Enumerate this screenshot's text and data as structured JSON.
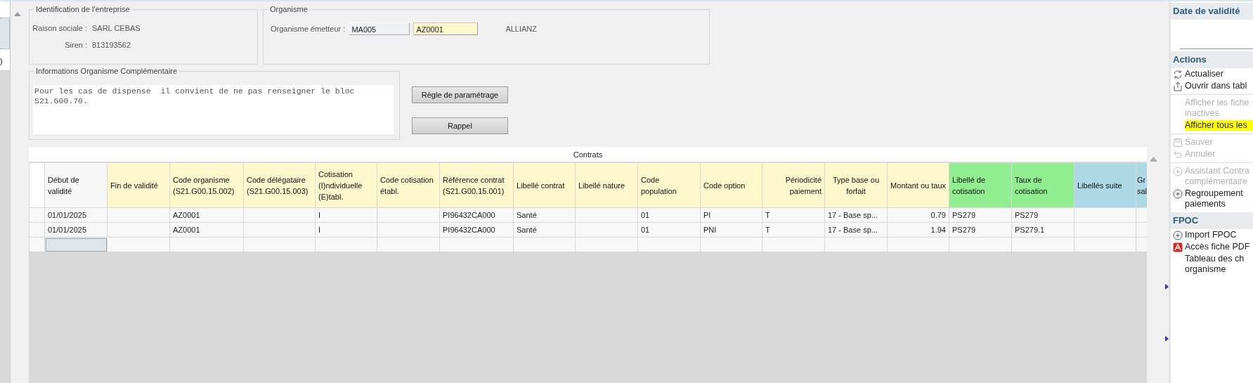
{
  "left_strip": {
    "text": ")"
  },
  "identification": {
    "title": "Identification de l'entreprise",
    "fields": [
      {
        "label": "Raison sociale :",
        "value": "SARL CEBAS"
      },
      {
        "label": "Siren :",
        "value": "813193562"
      }
    ]
  },
  "organisme": {
    "title": "Organisme",
    "label": "Organisme émetteur :",
    "code": "MA005",
    "value": "AZ0001",
    "name": "ALLIANZ"
  },
  "informations": {
    "title": "Informations Organisme Complémentaire",
    "text": "Pour les cas de dispense  il convient de ne pas renseigner le bloc S21.G00.70."
  },
  "buttons": [
    "Règle de paramétrage",
    "Rappel"
  ],
  "table": {
    "title": "Contrats",
    "columns": [
      {
        "label": "Début de validité",
        "color": "#f7f7f7"
      },
      {
        "label": "Fin de validité",
        "color": "#fff8cc"
      },
      {
        "label": "Code organisme (S21.G00.15.002)",
        "color": "#fff8cc"
      },
      {
        "label": "Code délégataire (S21.G00.15.003)",
        "color": "#fff8cc"
      },
      {
        "label": "Cotisation (I)ndividuelle (E)tabl.",
        "color": "#fff8cc"
      },
      {
        "label": "Code cotisation établ.",
        "color": "#fff8cc"
      },
      {
        "label": "Référence contrat (S21.G00.15.001)",
        "color": "#fff8cc"
      },
      {
        "label": "Libellé contrat",
        "color": "#fff8cc"
      },
      {
        "label": "Libellé nature",
        "color": "#fff8cc"
      },
      {
        "label": "Code population",
        "color": "#fff8cc"
      },
      {
        "label": "Code option",
        "color": "#fff8cc"
      },
      {
        "label": "Périodicité paiement",
        "color": "#fff8cc"
      },
      {
        "label": "Type base ou forfait",
        "color": "#fff8cc"
      },
      {
        "label": "Montant ou taux",
        "color": "#fff8cc"
      },
      {
        "label": "Libellé de cotisation",
        "color": "#90ee90"
      },
      {
        "label": "Taux de cotisation",
        "color": "#90ee90"
      },
      {
        "label": "Libellés suite",
        "color": "#add8e6"
      },
      {
        "label": "Gr sal",
        "color": "#add8e6"
      }
    ],
    "rows": [
      {
        "cells": [
          "01/01/2025",
          null,
          "AZ0001",
          null,
          "I",
          null,
          "PI96432CA000",
          "Santé",
          null,
          "01",
          "PI",
          "T",
          "17 - Base sp...",
          "0.79",
          "PS279",
          "PS279",
          null,
          null
        ]
      },
      {
        "cells": [
          "01/01/2025",
          null,
          "AZ0001",
          null,
          "I",
          null,
          "PI96432CA000",
          "Santé",
          null,
          "01",
          "PNI",
          "T",
          "17 - Base sp...",
          "1.94",
          "PS279",
          "PS279.1",
          null,
          null
        ]
      }
    ],
    "new_row": {
      "focused": true
    }
  },
  "side_panel": {
    "date_title": "Date de validité",
    "sections": [
      {
        "title": "Actions",
        "items": [
          {
            "label": "Actualiser",
            "disabled": false,
            "highlighted": false
          },
          {
            "label": "Ouvrir dans tabl",
            "disabled": false,
            "highlighted": false
          },
          {
            "label": "Afficher les fiche inactives",
            "disabled": true,
            "highlighted": false
          },
          {
            "label": "Afficher tous les",
            "disabled": false,
            "highlighted": true
          },
          {
            "label": "Sauver",
            "disabled": true,
            "highlighted": false
          },
          {
            "label": "Annuler",
            "disabled": true,
            "highlighted": false
          },
          {
            "label": "Assistant Contra complémentaire",
            "disabled": true,
            "highlighted": false
          },
          {
            "label": "Regroupement paiements",
            "disabled": false,
            "highlighted": false
          }
        ]
      },
      {
        "title": "FPOC",
        "items": [
          {
            "label": "Import FPOC",
            "disabled": false,
            "highlighted": false
          },
          {
            "label": "Accès fiche PDF",
            "disabled": false,
            "highlighted": false
          },
          {
            "label": "Tableau des ch organisme",
            "disabled": false,
            "highlighted": false
          }
        ]
      }
    ]
  }
}
